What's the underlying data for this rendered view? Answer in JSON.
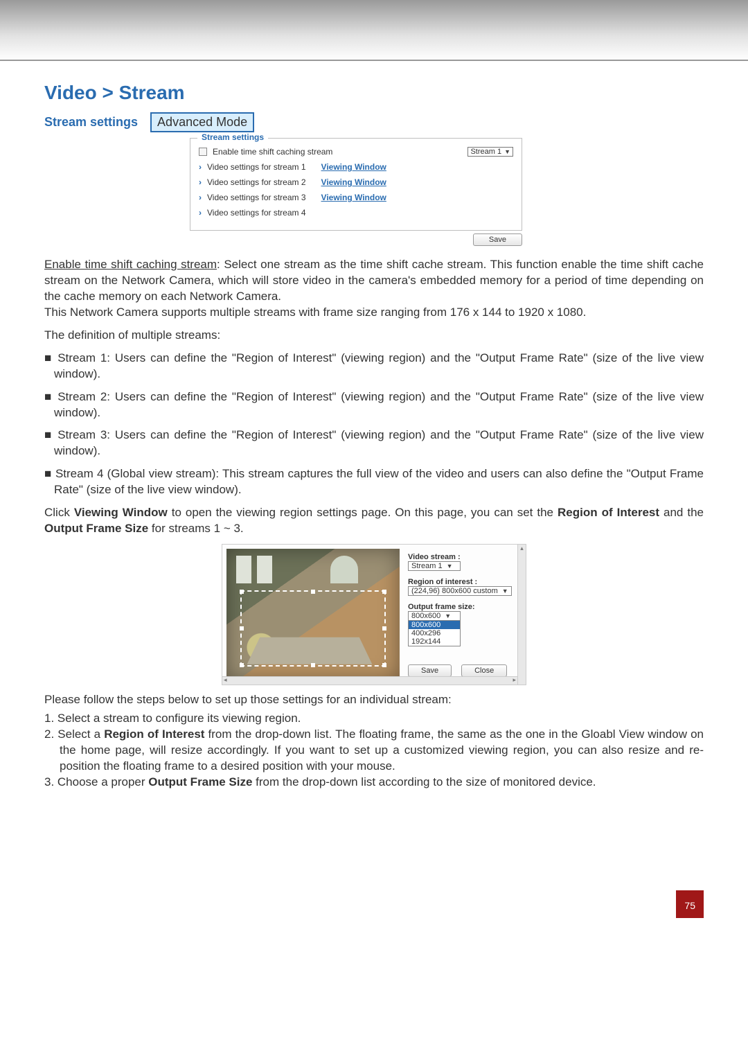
{
  "title": "Video > Stream",
  "subsection": "Stream settings",
  "mode_badge": "Advanced Mode",
  "shot1": {
    "legend": "Stream settings",
    "enable_label": "Enable time shift caching stream",
    "stream_dropdown": "Stream 1",
    "rows": [
      {
        "label": "Video settings for stream 1",
        "link": "Viewing Window"
      },
      {
        "label": "Video settings for stream 2",
        "link": "Viewing Window"
      },
      {
        "label": "Video settings for stream 3",
        "link": "Viewing Window"
      },
      {
        "label": "Video settings for stream 4",
        "link": ""
      }
    ],
    "save": "Save"
  },
  "body": {
    "p1_u": "Enable time shift caching stream",
    "p1_rest": ": Select one stream as the time shift cache stream. This function enable the time shift cache stream on the Network Camera, which will store video in the camera's embedded memory for a period of time depending on the cache memory on each Network Camera.",
    "p2": "This Network Camera supports multiple streams with frame size ranging from 176 x 144 to 1920 x 1080.",
    "def_head": "The definition of multiple streams:",
    "bullets": [
      "Stream 1: Users can define the \"Region of Interest\" (viewing region) and the \"Output Frame Rate\" (size of the live view window).",
      "Stream 2: Users can define the \"Region of Interest\" (viewing region) and the \"Output Frame Rate\" (size of the live view window).",
      "Stream 3: Users can define the \"Region of Interest\" (viewing region) and the \"Output Frame Rate\" (size of the live view window).",
      "Stream 4 (Global view stream): This stream captures the full view of the video and users can also define the \"Output Frame Rate\" (size of the live view window)."
    ],
    "p3_pre": "Click ",
    "p3_b1": "Viewing Window",
    "p3_mid": " to open the viewing region settings page. On this page, you can set the ",
    "p3_b2": "Region of Interest",
    "p3_mid2": " and the ",
    "p3_b3": "Output Frame Size",
    "p3_post": " for streams 1 ~ 3.",
    "steps_head": "Please follow the steps below to set up those settings for an individual stream:",
    "steps": {
      "s1": "1. Select a stream to configure its viewing region.",
      "s2a": "2. Select a ",
      "s2b": "Region of Interest",
      "s2c": " from the drop-down list. The floating frame, the same as the one in the Gloabl View window on the home page, will resize accordingly. If you want to set up a customized viewing region, you can also resize and re-position the floating frame to a desired position with your mouse.",
      "s3a": "3. Choose a proper ",
      "s3b": "Output Frame Size",
      "s3c": " from the drop-down list according to the size of monitored device."
    }
  },
  "shot2": {
    "video_stream_lbl": "Video stream :",
    "video_stream_val": "Stream 1",
    "roi_lbl": "Region of interest :",
    "roi_val": "(224,96) 800x600 custom",
    "ofs_lbl": "Output frame size:",
    "ofs_val": "800x600",
    "ofs_opts": [
      "800x600",
      "400x296",
      "192x144"
    ],
    "save": "Save",
    "close": "Close"
  },
  "page_number": "75"
}
